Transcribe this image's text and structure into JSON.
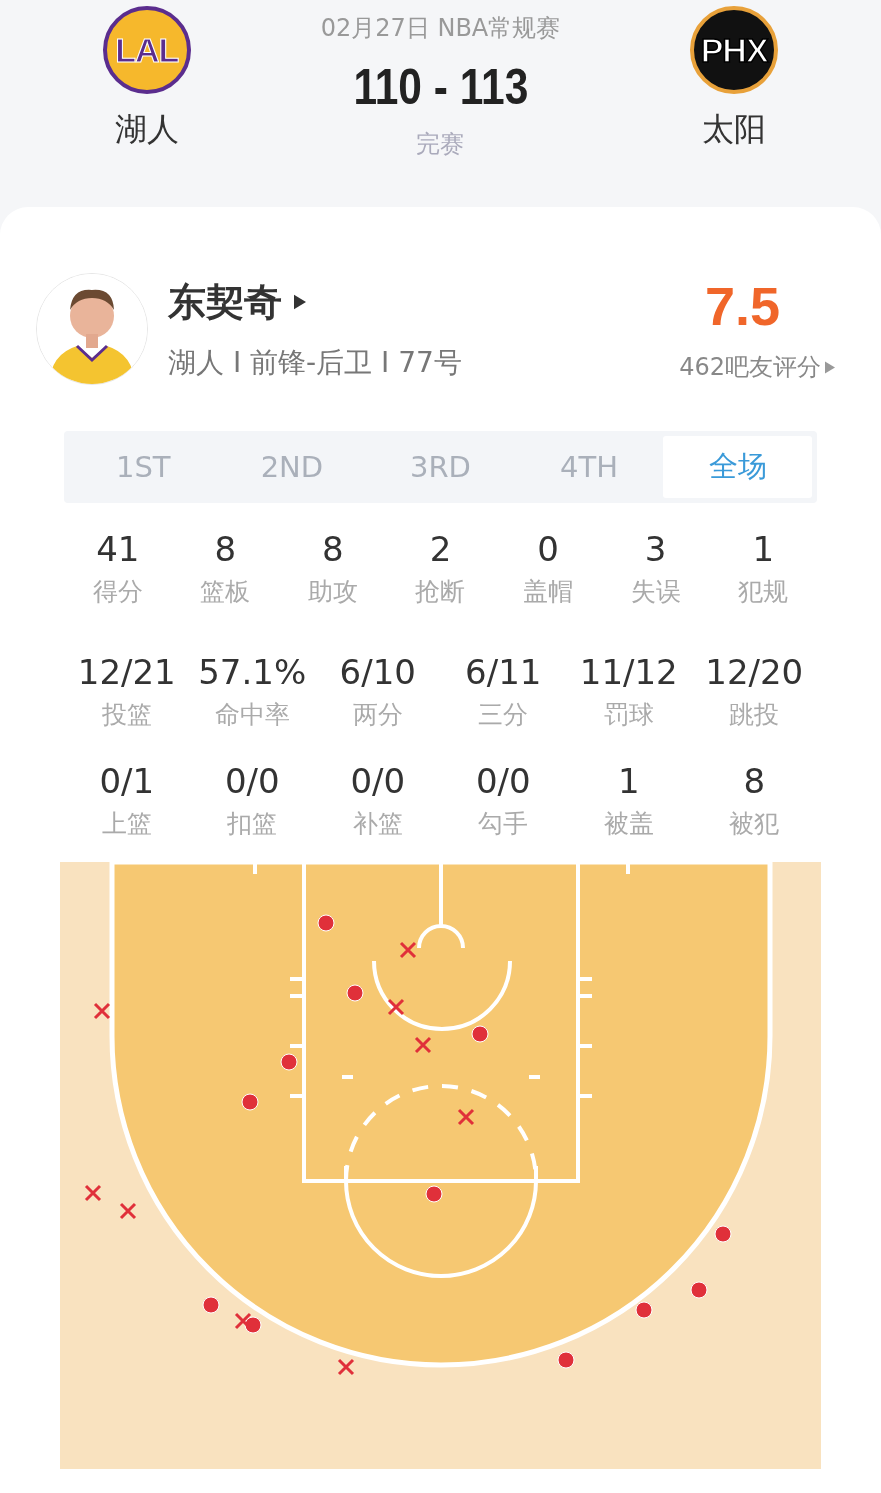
{
  "header": {
    "date_league": "02月27日 NBA常规赛",
    "score": "110 - 113",
    "status": "完赛",
    "home": {
      "logo_text": "LAL",
      "name": "湖人"
    },
    "away": {
      "logo_text": "PHX",
      "name": "太阳"
    }
  },
  "player": {
    "name": "东契奇",
    "info": "湖人 I 前锋-后卫 I 77号",
    "rating": "7.5",
    "rating_count": "462吧友评分"
  },
  "tabs": [
    {
      "label": "1ST",
      "selected": false
    },
    {
      "label": "2ND",
      "selected": false
    },
    {
      "label": "3RD",
      "selected": false
    },
    {
      "label": "4TH",
      "selected": false
    },
    {
      "label": "全场",
      "selected": true
    }
  ],
  "stats_main": [
    {
      "value": "41",
      "label": "得分"
    },
    {
      "value": "8",
      "label": "篮板"
    },
    {
      "value": "8",
      "label": "助攻"
    },
    {
      "value": "2",
      "label": "抢断"
    },
    {
      "value": "0",
      "label": "盖帽"
    },
    {
      "value": "3",
      "label": "失误"
    },
    {
      "value": "1",
      "label": "犯规"
    }
  ],
  "stats_shooting": [
    {
      "value": "12/21",
      "label": "投篮"
    },
    {
      "value": "57.1%",
      "label": "命中率"
    },
    {
      "value": "6/10",
      "label": "两分"
    },
    {
      "value": "6/11",
      "label": "三分"
    },
    {
      "value": "11/12",
      "label": "罚球"
    },
    {
      "value": "12/20",
      "label": "跳投"
    }
  ],
  "stats_detail": [
    {
      "value": "0/1",
      "label": "上篮"
    },
    {
      "value": "0/0",
      "label": "扣篮"
    },
    {
      "value": "0/0",
      "label": "补篮"
    },
    {
      "value": "0/0",
      "label": "勾手"
    },
    {
      "value": "1",
      "label": "被盖"
    },
    {
      "value": "8",
      "label": "被犯"
    }
  ],
  "shots": [
    {
      "made": true
    },
    {
      "made": true
    },
    {
      "made": true
    },
    {
      "made": true
    },
    {
      "made": true
    },
    {
      "made": true
    },
    {
      "made": true
    },
    {
      "made": true
    },
    {
      "made": true
    },
    {
      "made": true
    },
    {
      "made": true
    },
    {
      "made": true
    },
    {
      "made": false
    },
    {
      "made": false
    },
    {
      "made": false
    },
    {
      "made": false
    },
    {
      "made": false
    },
    {
      "made": false
    },
    {
      "made": false
    },
    {
      "made": false
    },
    {
      "made": false
    }
  ]
}
